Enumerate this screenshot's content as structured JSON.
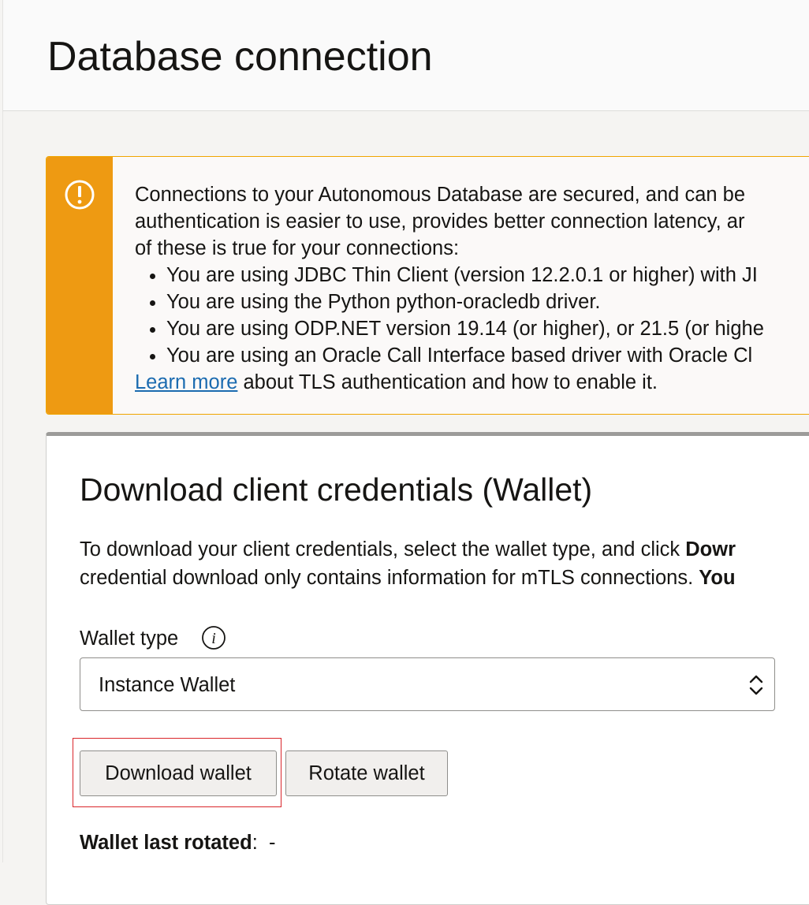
{
  "header": {
    "title": "Database connection"
  },
  "notice": {
    "icon": "warning-icon",
    "accent_color": "#ee9a12",
    "intro": "Connections to your Autonomous Database are secured, and can be",
    "intro_line2": "authentication is easier to use, provides better connection latency, ar",
    "intro_line3": "of these is true for your connections:",
    "items": [
      "You are using JDBC Thin Client (version 12.2.0.1 or higher) with JI",
      "You are using the Python python-oracledb driver.",
      "You are using ODP.NET version 19.14 (or higher), or 21.5 (or highe",
      "You are using an Oracle Call Interface based driver with Oracle Cl"
    ],
    "link_label": "Learn more",
    "link_suffix": " about TLS authentication and how to enable it."
  },
  "credentials": {
    "title": "Download client credentials (Wallet)",
    "desc_line1_prefix": "To download your client credentials, select the wallet type, and click ",
    "desc_line1_bold": "Dowr",
    "desc_line2_prefix": "credential download only contains information for mTLS connections. ",
    "desc_line2_bold": "You",
    "wallet_type_label": "Wallet type",
    "info_icon": "info-icon",
    "wallet_type_value": "Instance Wallet",
    "download_button": "Download wallet",
    "rotate_button": "Rotate wallet",
    "last_rotated_label": "Wallet last rotated",
    "last_rotated_sep": ":",
    "last_rotated_value": "-"
  },
  "highlight_color": "#d9262b"
}
